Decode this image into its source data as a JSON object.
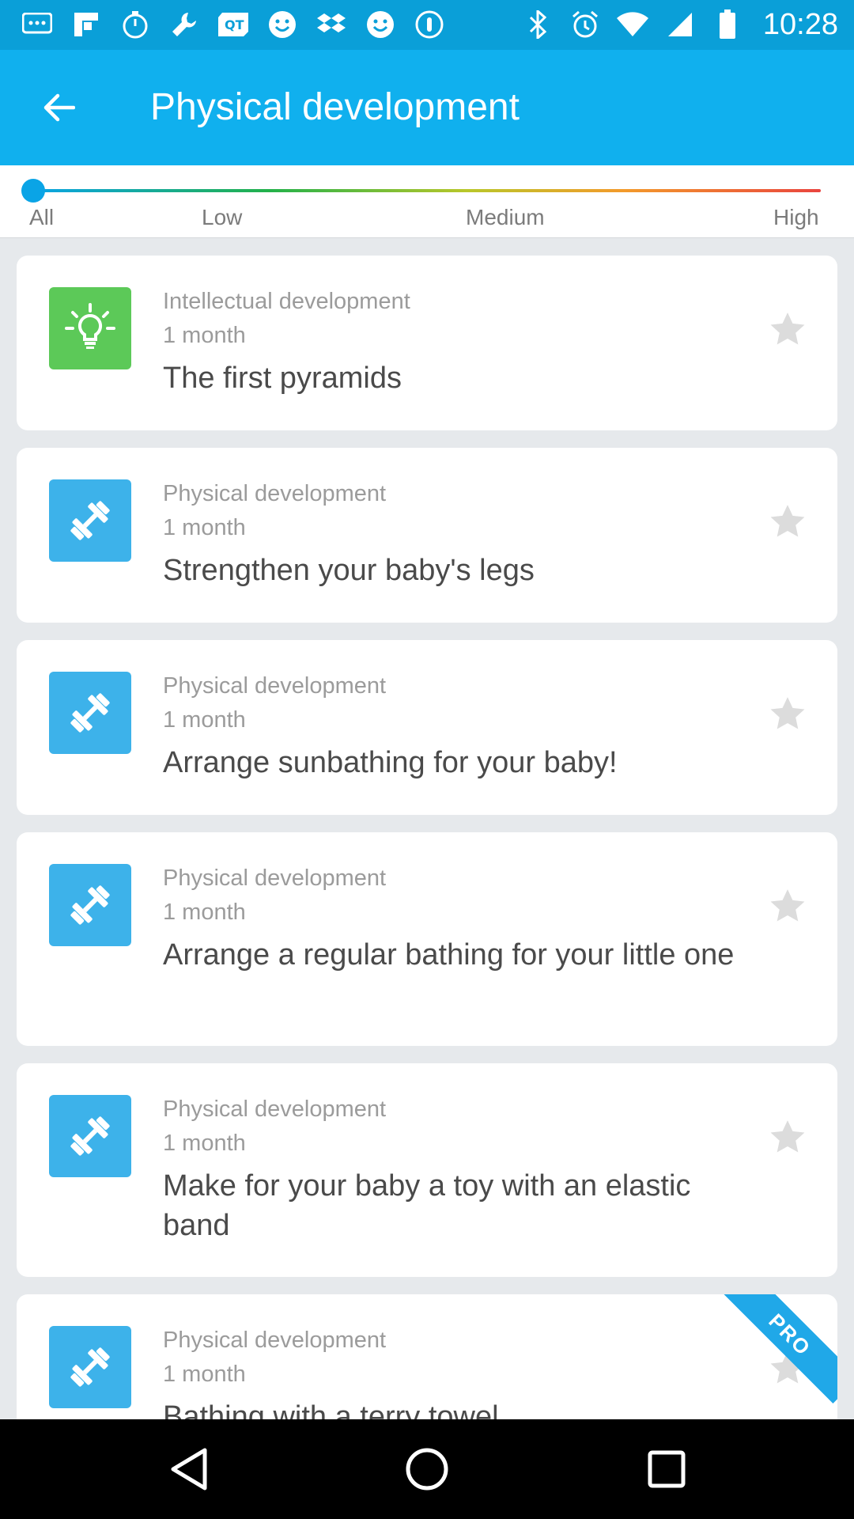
{
  "status_bar": {
    "time": "10:28",
    "left_icons": [
      "chat-icon",
      "flipboard-icon",
      "timer-icon",
      "wrench-icon",
      "qt-icon",
      "smiley-icon",
      "dropbox-icon",
      "smiley-icon",
      "info-icon"
    ],
    "right_icons": [
      "bluetooth-icon",
      "alarm-icon",
      "wifi-icon",
      "signal-icon",
      "battery-icon"
    ]
  },
  "app_bar": {
    "title": "Physical development",
    "back_icon": "arrow-left-icon"
  },
  "filter": {
    "labels": [
      "All",
      "Low",
      "Medium",
      "High"
    ],
    "selected": "All",
    "colors": [
      "#0aa4e6",
      "#23b14a",
      "#b9c72a",
      "#f39a2b",
      "#e9443e"
    ]
  },
  "cards": [
    {
      "category": "Intellectual development",
      "age": "1 month",
      "title": "The first pyramids",
      "icon": "lightbulb-icon",
      "color": "#5cc958",
      "pro": false
    },
    {
      "category": "Physical development",
      "age": "1 month",
      "title": "Strengthen your baby's legs",
      "icon": "dumbbell-icon",
      "color": "#3db2ea",
      "pro": false
    },
    {
      "category": "Physical development",
      "age": "1 month",
      "title": "Arrange sunbathing for your baby!",
      "icon": "dumbbell-icon",
      "color": "#3db2ea",
      "pro": false
    },
    {
      "category": "Physical development",
      "age": "1 month",
      "title": "Arrange a regular bathing for your little one",
      "icon": "dumbbell-icon",
      "color": "#3db2ea",
      "pro": false
    },
    {
      "category": "Physical development",
      "age": "1 month",
      "title": "Make for your baby a toy with an elastic band",
      "icon": "dumbbell-icon",
      "color": "#3db2ea",
      "pro": false
    },
    {
      "category": "Physical development",
      "age": "1 month",
      "title": "Bathing with a terry towel",
      "icon": "dumbbell-icon",
      "color": "#3db2ea",
      "pro": true,
      "pro_label": "PRO"
    }
  ],
  "nav_bar": {
    "buttons": [
      "back-triangle-icon",
      "home-circle-icon",
      "recents-square-icon"
    ]
  }
}
